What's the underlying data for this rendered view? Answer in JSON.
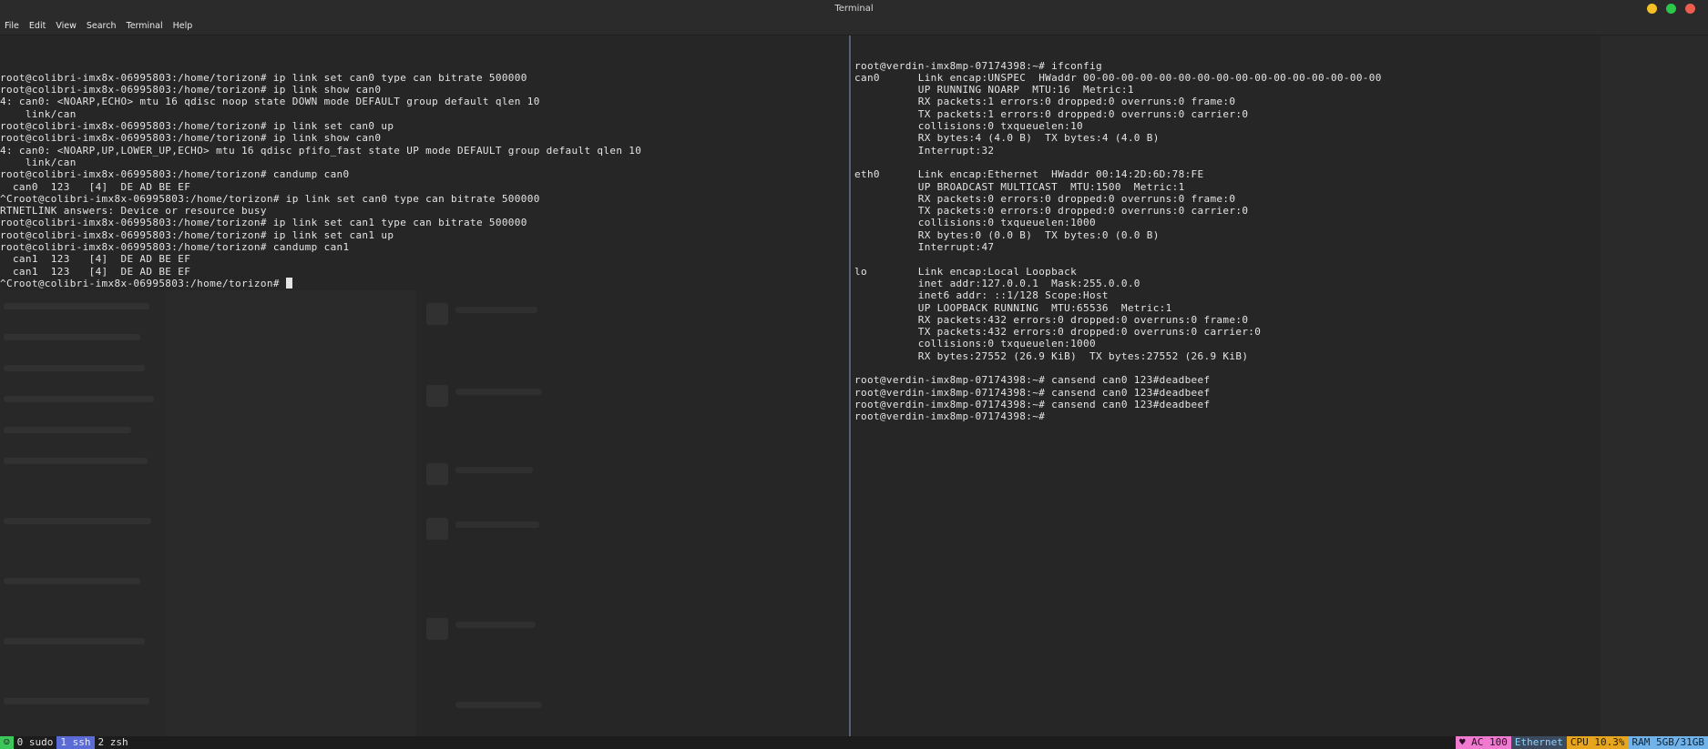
{
  "window": {
    "title": "Terminal"
  },
  "menu": [
    "File",
    "Edit",
    "View",
    "Search",
    "Terminal",
    "Help"
  ],
  "colors": {
    "close": "#ed5e4e",
    "minimize": "#f4c025",
    "maximize": "#2cc64a"
  },
  "left_pane": {
    "lines": [
      "root@colibri-imx8x-06995803:/home/torizon# ip link set can0 type can bitrate 500000",
      "root@colibri-imx8x-06995803:/home/torizon# ip link show can0",
      "4: can0: <NOARP,ECHO> mtu 16 qdisc noop state DOWN mode DEFAULT group default qlen 10",
      "    link/can",
      "root@colibri-imx8x-06995803:/home/torizon# ip link set can0 up",
      "root@colibri-imx8x-06995803:/home/torizon# ip link show can0",
      "4: can0: <NOARP,UP,LOWER_UP,ECHO> mtu 16 qdisc pfifo_fast state UP mode DEFAULT group default qlen 10",
      "    link/can",
      "root@colibri-imx8x-06995803:/home/torizon# candump can0",
      "  can0  123   [4]  DE AD BE EF",
      "^Croot@colibri-imx8x-06995803:/home/torizon# ip link set can0 type can bitrate 500000",
      "RTNETLINK answers: Device or resource busy",
      "root@colibri-imx8x-06995803:/home/torizon# ip link set can1 type can bitrate 500000",
      "root@colibri-imx8x-06995803:/home/torizon# ip link set can1 up",
      "root@colibri-imx8x-06995803:/home/torizon# candump can1",
      "  can1  123   [4]  DE AD BE EF",
      "  can1  123   [4]  DE AD BE EF"
    ],
    "prompt_line": "^Croot@colibri-imx8x-06995803:/home/torizon# "
  },
  "right_pane": {
    "lines": [
      "root@verdin-imx8mp-07174398:~# ifconfig",
      "can0      Link encap:UNSPEC  HWaddr 00-00-00-00-00-00-00-00-00-00-00-00-00-00-00-00",
      "          UP RUNNING NOARP  MTU:16  Metric:1",
      "          RX packets:1 errors:0 dropped:0 overruns:0 frame:0",
      "          TX packets:1 errors:0 dropped:0 overruns:0 carrier:0",
      "          collisions:0 txqueuelen:10",
      "          RX bytes:4 (4.0 B)  TX bytes:4 (4.0 B)",
      "          Interrupt:32",
      "",
      "eth0      Link encap:Ethernet  HWaddr 00:14:2D:6D:78:FE",
      "          UP BROADCAST MULTICAST  MTU:1500  Metric:1",
      "          RX packets:0 errors:0 dropped:0 overruns:0 frame:0",
      "          TX packets:0 errors:0 dropped:0 overruns:0 carrier:0",
      "          collisions:0 txqueuelen:1000",
      "          RX bytes:0 (0.0 B)  TX bytes:0 (0.0 B)",
      "          Interrupt:47",
      "",
      "lo        Link encap:Local Loopback",
      "          inet addr:127.0.0.1  Mask:255.0.0.0",
      "          inet6 addr: ::1/128 Scope:Host",
      "          UP LOOPBACK RUNNING  MTU:65536  Metric:1",
      "          RX packets:432 errors:0 dropped:0 overruns:0 frame:0",
      "          TX packets:432 errors:0 dropped:0 overruns:0 carrier:0",
      "          collisions:0 txqueuelen:1000",
      "          RX bytes:27552 (26.9 KiB)  TX bytes:27552 (26.9 KiB)",
      "",
      "root@verdin-imx8mp-07174398:~# cansend can0 123#deadbeef",
      "root@verdin-imx8mp-07174398:~# cansend can0 123#deadbeef",
      "root@verdin-imx8mp-07174398:~# cansend can0 123#deadbeef",
      "root@verdin-imx8mp-07174398:~# "
    ]
  },
  "statusbar": {
    "left": [
      {
        "name": "session-icon",
        "text": "☺",
        "bg": "#3cc75a",
        "fg": "#1a1a1a"
      },
      {
        "name": "window-0",
        "text": "0 sudo",
        "bg": "#1c1c1c",
        "fg": "#e0e0e0"
      },
      {
        "name": "window-1",
        "text": "1 ssh",
        "bg": "#5b6bd6",
        "fg": "#e8eaff"
      },
      {
        "name": "window-2",
        "text": "2 zsh",
        "bg": "#1c1c1c",
        "fg": "#e0e0e0"
      }
    ],
    "right": [
      {
        "name": "battery-status",
        "text": "♥ AC  100",
        "bg": "#f07ad0",
        "fg": "#2a0c24"
      },
      {
        "name": "network-status",
        "text": "Ethernet",
        "bg": "#3b4a5e",
        "fg": "#8fd3ff"
      },
      {
        "name": "cpu-status",
        "text": "CPU 10.3%",
        "bg": "#e6a51c",
        "fg": "#2a1a00"
      },
      {
        "name": "ram-status",
        "text": "RAM 5GB/31GB",
        "bg": "#6fb3ea",
        "fg": "#0d2233"
      }
    ]
  }
}
